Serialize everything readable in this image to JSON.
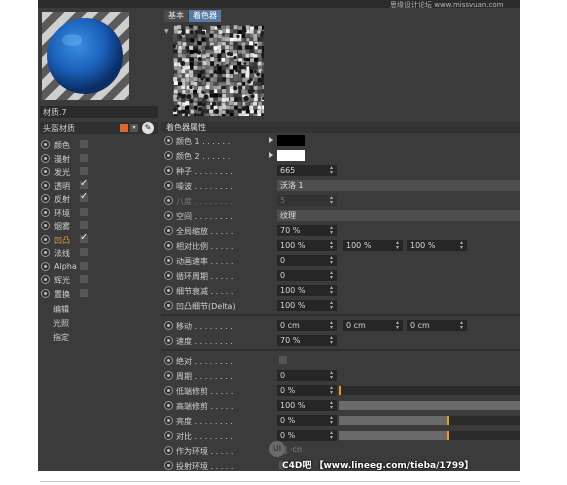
{
  "header": {
    "site_watermark": "思缘设计论坛 www.missvuan.com"
  },
  "left_panel": {
    "material_name": "材质.7",
    "head_material_label": "头盔材质",
    "head_material_color": "#d9692e",
    "channels": [
      {
        "name": "颜色",
        "checked": false,
        "active": false
      },
      {
        "name": "漫射",
        "checked": false,
        "active": false
      },
      {
        "name": "发光",
        "checked": false,
        "active": false
      },
      {
        "name": "透明",
        "checked": true,
        "active": false
      },
      {
        "name": "反射",
        "checked": true,
        "active": false
      },
      {
        "name": "环境",
        "checked": false,
        "active": false
      },
      {
        "name": "烟雾",
        "checked": false,
        "active": false
      },
      {
        "name": "凹凸",
        "checked": true,
        "active": true
      },
      {
        "name": "法线",
        "checked": false,
        "active": false
      },
      {
        "name": "Alpha",
        "checked": false,
        "active": false
      },
      {
        "name": "辉光",
        "checked": false,
        "active": false
      },
      {
        "name": "置换",
        "checked": false,
        "active": false
      }
    ],
    "sub_items": [
      "编辑",
      "光照",
      "指定"
    ]
  },
  "tabs": [
    {
      "label": "基本",
      "active": false
    },
    {
      "label": "着色器",
      "active": true
    }
  ],
  "section_title": "着色器属性",
  "props": {
    "color1": {
      "label": "颜色 1 . . . . . .",
      "value": "#000000"
    },
    "color2": {
      "label": "颜色 2 . . . . . .",
      "value": "#ffffff"
    },
    "seed": {
      "label": "种子 . . . . . . . .",
      "value": "665"
    },
    "noise": {
      "label": "噪波 . . . . . . . .",
      "value": "沃洛 1"
    },
    "octaves": {
      "label": "八度 . . . . . . . .",
      "value": "5"
    },
    "space": {
      "label": "空间 . . . . . . . .",
      "value": "纹理"
    },
    "global_scale": {
      "label": "全局缩放 . . . . .",
      "value": "70 %"
    },
    "relative_scale": {
      "label": "相对比例 . . . . .",
      "values": [
        "100 %",
        "100 %",
        "100 %"
      ]
    },
    "anim_speed": {
      "label": "动画速率 . . . . .",
      "value": "0"
    },
    "loop_period": {
      "label": "循环周期 . . . . .",
      "value": "0"
    },
    "detail_atten": {
      "label": "细节衰减 . . . . .",
      "value": "100 %"
    },
    "bump_delta": {
      "label": "凹凸细节(Delta)",
      "value": "100 %"
    },
    "move": {
      "label": "移动 . . . . . . . .",
      "values": [
        "0 cm",
        "0 cm",
        "0 cm"
      ]
    },
    "speed": {
      "label": "速度 . . . . . . . .",
      "value": "70 %"
    },
    "absolute": {
      "label": "绝对 . . . . . . . ."
    },
    "period": {
      "label": "周期 . . . . . . . .",
      "value": "0"
    },
    "low_clip": {
      "label": "低端修剪 . . . . .",
      "value": "0 %",
      "level": 0.0
    },
    "high_clip": {
      "label": "高端修剪 . . . . .",
      "value": "100 %",
      "level": 1.0
    },
    "brightness": {
      "label": "亮度 . . . . . . . .",
      "value": "0 %",
      "level": 0.5
    },
    "contrast": {
      "label": "对比 . . . . . . . .",
      "value": "0 %",
      "level": 0.5
    },
    "as_env": {
      "label": "作为环境 . . . . ."
    },
    "project_env": {
      "label": "投射环境 . . . . ."
    }
  },
  "watermark": {
    "logo_text": "UI",
    "cn_text": "·cn",
    "bottom": "C4D吧 【www.lineeg.com/tieba/1799】"
  },
  "colors": {
    "accent": "#e8a24a",
    "tab_active": "#577aa6",
    "slider_mark": "#e0a028"
  }
}
